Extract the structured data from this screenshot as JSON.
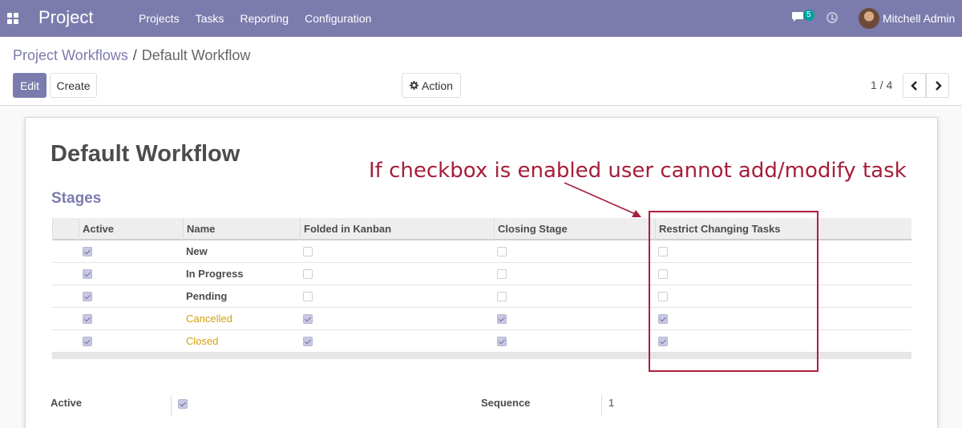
{
  "navbar": {
    "brand": "Project",
    "menu": [
      "Projects",
      "Tasks",
      "Reporting",
      "Configuration"
    ],
    "chat_count": "5",
    "user_name": "Mitchell Admin"
  },
  "breadcrumb": {
    "parent": "Project Workflows",
    "separator": "/",
    "current": "Default Workflow"
  },
  "buttons": {
    "edit": "Edit",
    "create": "Create",
    "action": "Action"
  },
  "pager": {
    "value": "1 / 4"
  },
  "form": {
    "title": "Default Workflow",
    "stages_heading": "Stages",
    "columns": [
      "Active",
      "Name",
      "Folded in Kanban",
      "Closing Stage",
      "Restrict Changing Tasks"
    ],
    "rows": [
      {
        "active": true,
        "name": "New",
        "folded": false,
        "closing": false,
        "restrict": false
      },
      {
        "active": true,
        "name": "In Progress",
        "folded": false,
        "closing": false,
        "restrict": false
      },
      {
        "active": true,
        "name": "Pending",
        "folded": false,
        "closing": false,
        "restrict": false
      },
      {
        "active": true,
        "name": "Cancelled",
        "folded": true,
        "closing": true,
        "restrict": true
      },
      {
        "active": true,
        "name": "Closed",
        "folded": true,
        "closing": true,
        "restrict": true
      }
    ],
    "active_label": "Active",
    "active_value": true,
    "sequence_label": "Sequence",
    "sequence_value": "1"
  },
  "annotation": {
    "text": "If checkbox is enabled user cannot add/modify task",
    "color": "#a51e3a"
  },
  "colors": {
    "brand": "#7c7bad",
    "folded_text": "#d4a10c"
  }
}
